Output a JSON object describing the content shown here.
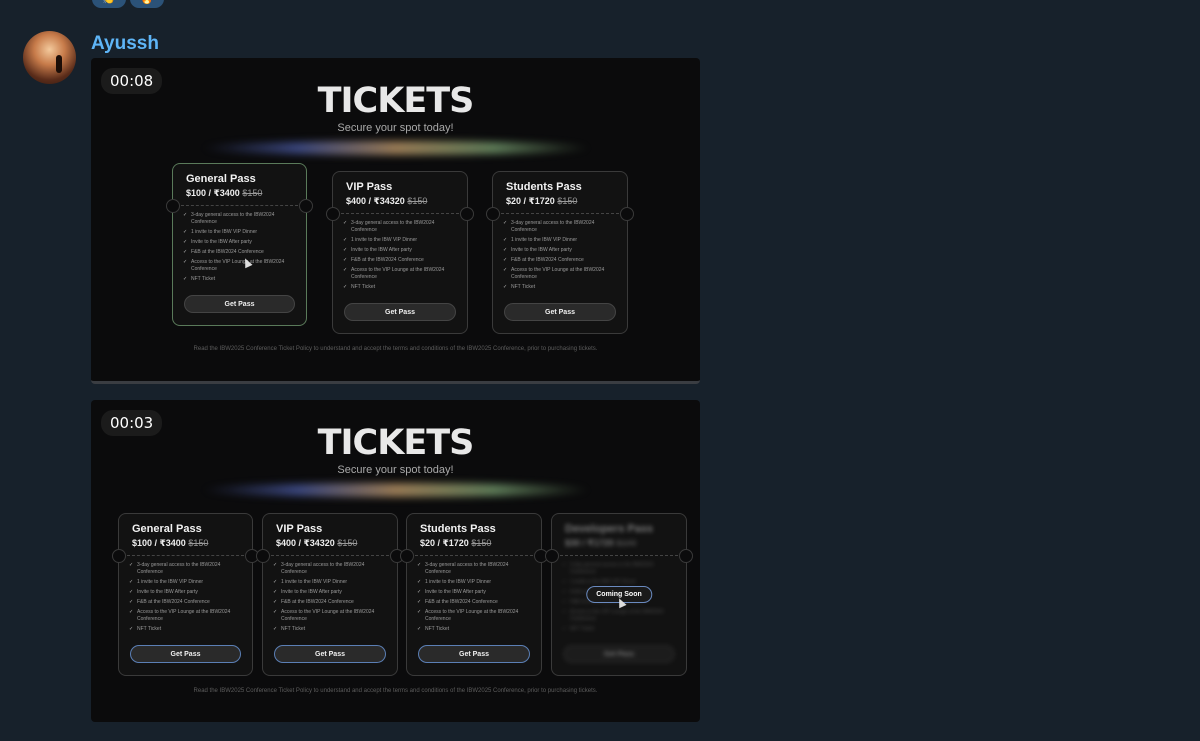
{
  "message": {
    "sender": "Ayussh",
    "reactions": [
      "👏",
      "🔥"
    ]
  },
  "videos": [
    {
      "duration": "00:08",
      "title": "TICKETS",
      "subtitle": "Secure your spot today!",
      "policy": "Read the IBW2025 Conference Ticket Policy to understand and accept the terms and conditions of the IBW2025 Conference, prior to purchasing tickets.",
      "cards": [
        {
          "name": "General Pass",
          "price": "$100 / ₹3400",
          "old": "$150",
          "button": "Get Pass",
          "features": [
            "3-day general access to the IBW2024 Conference",
            "1 invite to the IBW VIP Dinner",
            "Invite to the IBW After party",
            "F&B at the IBW2024 Conference",
            "Access to the VIP Lounge at the IBW2024 Conference",
            "NFT Ticket"
          ]
        },
        {
          "name": "VIP Pass",
          "price": "$400 / ₹34320",
          "old": "$150",
          "button": "Get Pass",
          "features": [
            "3-day general access to the IBW2024 Conference",
            "1 invite to the IBW VIP Dinner",
            "Invite to the IBW After party",
            "F&B at the IBW2024 Conference",
            "Access to the VIP Lounge at the IBW2024 Conference",
            "NFT Ticket"
          ]
        },
        {
          "name": "Students Pass",
          "price": "$20 / ₹1720",
          "old": "$150",
          "button": "Get Pass",
          "features": [
            "3-day general access to the IBW2024 Conference",
            "1 invite to the IBW VIP Dinner",
            "Invite to the IBW After party",
            "F&B at the IBW2024 Conference",
            "Access to the VIP Lounge at the IBW2024 Conference",
            "NFT Ticket"
          ]
        }
      ]
    },
    {
      "duration": "00:03",
      "title": "TICKETS",
      "subtitle": "Secure your spot today!",
      "policy": "Read the IBW2025 Conference Ticket Policy to understand and accept the terms and conditions of the IBW2025 Conference, prior to purchasing tickets.",
      "cards": [
        {
          "name": "General Pass",
          "price": "$100 / ₹3400",
          "old": "$150",
          "button": "Get Pass",
          "features": [
            "3-day general access to the IBW2024 Conference",
            "1 invite to the IBW VIP Dinner",
            "Invite to the IBW After party",
            "F&B at the IBW2024 Conference",
            "Access to the VIP Lounge at the IBW2024 Conference",
            "NFT Ticket"
          ]
        },
        {
          "name": "VIP Pass",
          "price": "$400 / ₹34320",
          "old": "$150",
          "button": "Get Pass",
          "features": [
            "3-day general access to the IBW2024 Conference",
            "1 invite to the IBW VIP Dinner",
            "Invite to the IBW After party",
            "F&B at the IBW2024 Conference",
            "Access to the VIP Lounge at the IBW2024 Conference",
            "NFT Ticket"
          ]
        },
        {
          "name": "Students Pass",
          "price": "$20 / ₹1720",
          "old": "$150",
          "button": "Get Pass",
          "features": [
            "3-day general access to the IBW2024 Conference",
            "1 invite to the IBW VIP Dinner",
            "Invite to the IBW After party",
            "F&B at the IBW2024 Conference",
            "Access to the VIP Lounge at the IBW2024 Conference",
            "NFT Ticket"
          ]
        },
        {
          "name": "Developers Pass",
          "price": "$30 / ₹1720",
          "old": "$100",
          "button": "Get Pass",
          "overlay": "Coming Soon",
          "features": [
            "3-day general access to the IBW2024 Conference",
            "1 invite to the IBW VIP Dinner",
            "Invite to the IBW After party",
            "F&B at the IBW2024 Conference",
            "Access to the VIP Lounge at the IBW2024 Conference",
            "NFT Ticket"
          ]
        }
      ]
    }
  ]
}
